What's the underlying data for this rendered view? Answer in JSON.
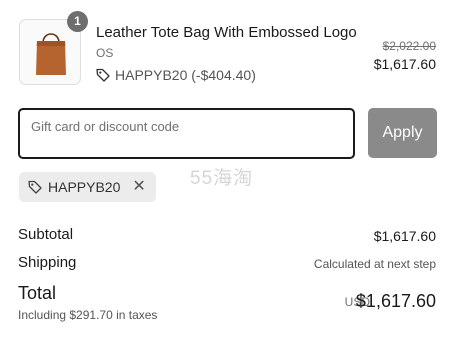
{
  "product": {
    "quantity": "1",
    "name": "Leather Tote Bag With Embossed Logo",
    "variant": "OS",
    "discount_line": "HAPPYB20 (-$404.40)",
    "original_price": "$2,022.00",
    "final_price": "$1,617.60"
  },
  "discount_form": {
    "placeholder": "Gift card or discount code",
    "value": "",
    "apply_label": "Apply"
  },
  "applied_code": {
    "code": "HAPPYB20"
  },
  "watermark": "55海淘",
  "summary": {
    "subtotal_label": "Subtotal",
    "subtotal_value": "$1,617.60",
    "shipping_label": "Shipping",
    "shipping_value": "Calculated at next step",
    "total_label": "Total",
    "tax_note": "Including $291.70 in taxes",
    "currency": "USD",
    "total_value": "$1,617.60"
  },
  "icons": {
    "tag": "tag-icon",
    "remove": "close-icon"
  },
  "colors": {
    "apply_button_bg": "#8a8a8a",
    "chip_bg": "#ececec",
    "bag_leather": "#b5642f"
  }
}
